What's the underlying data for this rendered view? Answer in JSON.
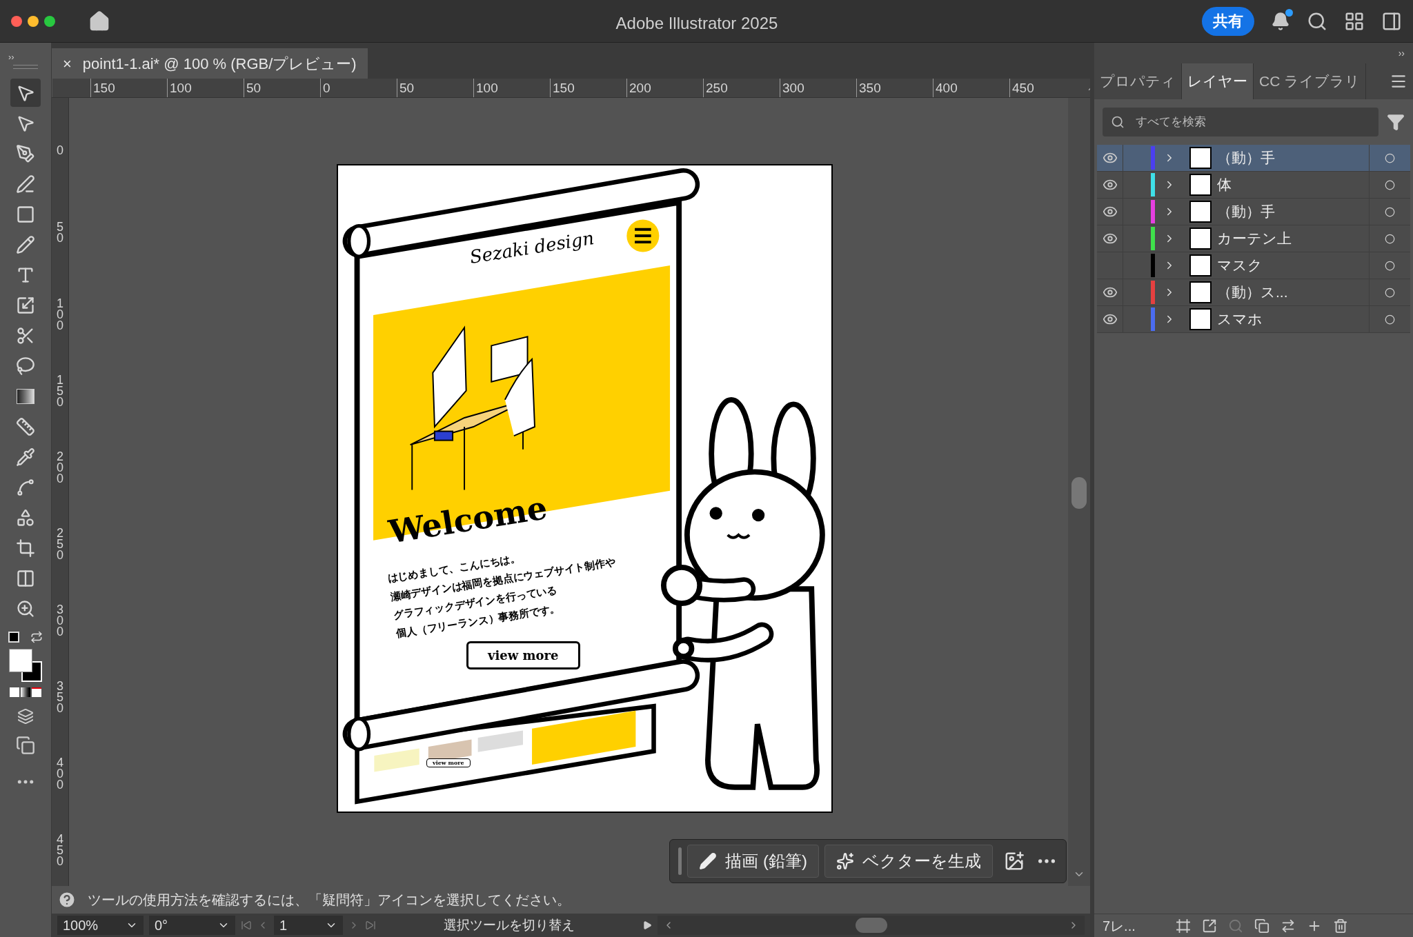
{
  "window": {
    "title": "Adobe Illustrator 2025",
    "share_label": "共有",
    "notification_badge": true
  },
  "toolbar_collapse": "››",
  "document_tab": {
    "title": "point1-1.ai* @ 100 % (RGB/プレビュー)",
    "close": "×"
  },
  "tools": [
    {
      "selected": true
    },
    {
      "selected": false
    },
    {
      "selected": false
    },
    {
      "selected": false
    },
    {
      "selected": false
    },
    {
      "selected": false
    },
    {
      "selected": false
    },
    {
      "selected": false
    },
    {
      "selected": false
    },
    {
      "selected": false
    },
    {
      "selected": false
    },
    {
      "selected": false
    },
    {
      "selected": false
    },
    {
      "selected": false
    },
    {
      "selected": false
    },
    {
      "selected": false
    },
    {
      "selected": false
    },
    {
      "selected": false
    }
  ],
  "ruler_horizontal": [
    "150",
    "100",
    "50",
    "0",
    "50",
    "100",
    "150",
    "200",
    "250",
    "300",
    "350",
    "400",
    "450"
  ],
  "ruler_vertical": [
    "0",
    "50",
    "100",
    "150",
    "200",
    "250",
    "300",
    "350",
    "400",
    "450"
  ],
  "artwork": {
    "logo": "Sezaki design",
    "heading": "Welcome",
    "body": [
      "はじめまして、こんにちは。",
      "瀬崎デザインは福岡を拠点にウェブサイト制作や",
      "グラフィックデザインを行っている",
      "個人（フリーランス）事務所です。"
    ],
    "button": "view more",
    "small_button": "view more"
  },
  "task_bar": {
    "buttons": [
      "描画 (鉛筆)",
      "ベクターを生成"
    ]
  },
  "help_text": "ツールの使用方法を確認するには、「疑問符」アイコンを選択してください。",
  "status_bar": {
    "zoom": "100%",
    "rotation": "0°",
    "artboard": "1",
    "tool_hint": "選択ツールを切り替え"
  },
  "panel": {
    "collapse": "››",
    "tabs": [
      {
        "label": "プロパティ",
        "selected": false
      },
      {
        "label": "レイヤー",
        "selected": true
      },
      {
        "label": "CC ライブラリ",
        "selected": false
      }
    ],
    "search": {
      "placeholder": "すべてを検索"
    },
    "layers": [
      {
        "name": "（動）手",
        "visible": true,
        "color": "#4b3ff0",
        "selected": true
      },
      {
        "name": "体",
        "visible": true,
        "color": "#3fe0e8",
        "selected": false
      },
      {
        "name": "（動）手",
        "visible": true,
        "color": "#e63fe0",
        "selected": false
      },
      {
        "name": "カーテン上",
        "visible": true,
        "color": "#3fe04b",
        "selected": false
      },
      {
        "name": "マスク",
        "visible": false,
        "color": "#000000",
        "selected": false
      },
      {
        "name": "（動）ス...",
        "visible": true,
        "color": "#e64040",
        "selected": false
      },
      {
        "name": "スマホ",
        "visible": true,
        "color": "#4b6cf0",
        "selected": false
      }
    ],
    "layer_count": "7レ..."
  }
}
